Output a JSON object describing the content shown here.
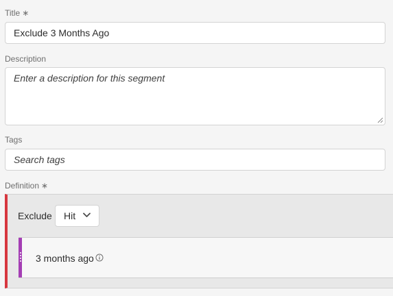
{
  "title": {
    "label": "Title",
    "required_mark": "∗",
    "value": "Exclude 3 Months Ago"
  },
  "description": {
    "label": "Description",
    "placeholder": "Enter a description for this segment"
  },
  "tags": {
    "label": "Tags",
    "placeholder": "Search tags"
  },
  "definition": {
    "label": "Definition",
    "required_mark": "∗",
    "mode_label": "Exclude",
    "scope_value": "Hit",
    "rule_name": "3 months ago",
    "accent_color": "#d7373f",
    "rule_color": "#a43eb4"
  },
  "icons": [
    "chevron-down-icon",
    "info-icon",
    "drag-handle-icon",
    "resize-grip-icon"
  ]
}
